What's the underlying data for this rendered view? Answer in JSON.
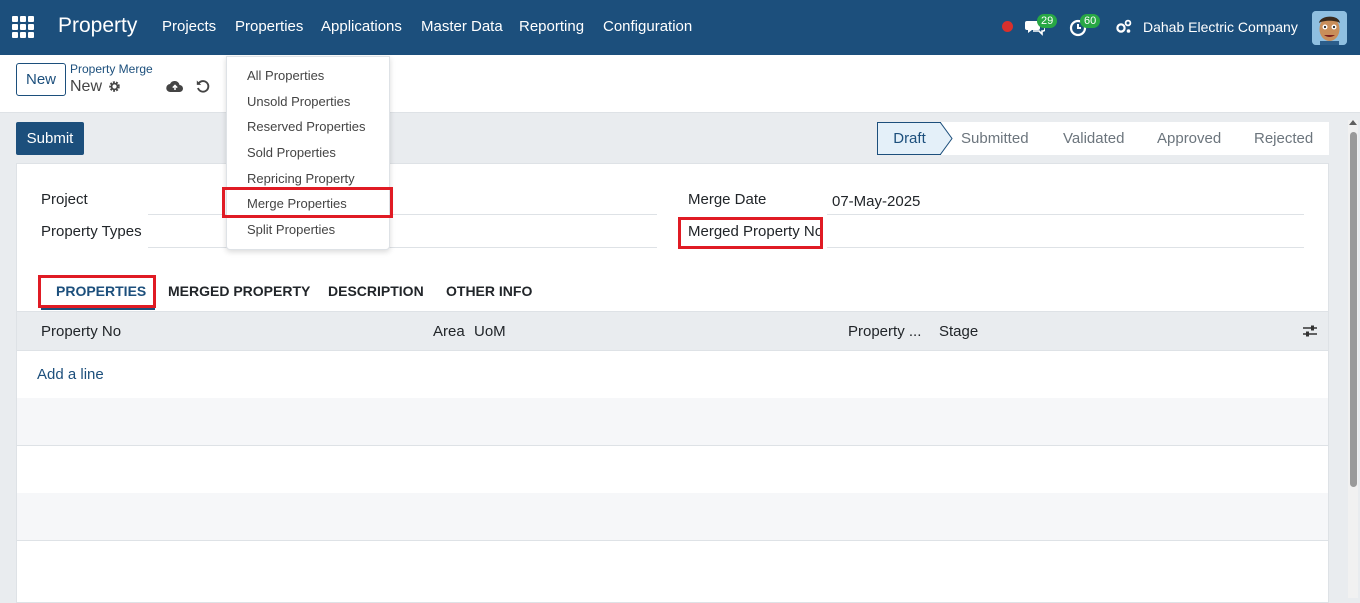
{
  "navbar": {
    "brand": "Property",
    "menus": [
      "Projects",
      "Properties",
      "Applications",
      "Master Data",
      "Reporting",
      "Configuration"
    ],
    "messages_count": "29",
    "activities_count": "60",
    "company": "Dahab Electric Company",
    "colors": {
      "navbar": "#1c4f7c",
      "badge": "#28a745",
      "highlight": "#e01b24"
    }
  },
  "control_panel": {
    "new_label": "New",
    "breadcrumb_parent": "Property Merge",
    "breadcrumb_current": "New"
  },
  "dropdown": {
    "items": [
      "All Properties",
      "Unsold Properties",
      "Reserved Properties",
      "Sold Properties",
      "Repricing Property",
      "Merge Properties",
      "Split Properties"
    ]
  },
  "form": {
    "submit_label": "Submit",
    "statuses": [
      "Draft",
      "Submitted",
      "Validated",
      "Approved",
      "Rejected"
    ],
    "fields": {
      "project_label": "Project",
      "property_types_label": "Property Types",
      "merge_date_label": "Merge Date",
      "merge_date_value": "07-May-2025",
      "merged_property_no_label": "Merged Property No"
    },
    "tabs": [
      "PROPERTIES",
      "MERGED PROPERTY",
      "DESCRIPTION",
      "OTHER INFO"
    ],
    "table": {
      "columns": [
        "Property No",
        "Area",
        "UoM",
        "Property ...",
        "Stage"
      ],
      "add_line": "Add a line"
    }
  }
}
